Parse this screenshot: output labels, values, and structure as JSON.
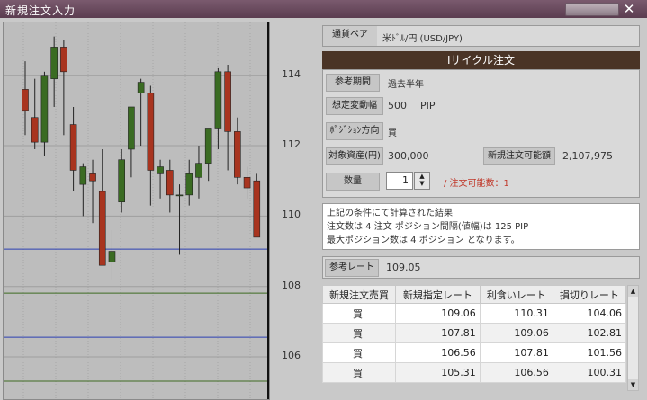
{
  "window": {
    "title": "新規注文入力",
    "close_glyph": "✕"
  },
  "pair": {
    "label": "通貨ペア",
    "value": "米ﾄﾞﾙ/円 (USD/JPY)"
  },
  "cycle": {
    "header": "Iサイクル注文",
    "period_label": "参考期間",
    "period_value": "過去半年",
    "range_label": "想定変動幅",
    "range_value": "500",
    "range_unit": "PIP",
    "direction_label": "ﾎﾟｼﾞｼｮﾝ方向",
    "direction_value": "買",
    "assets_label": "対象資産(円)",
    "assets_value": "300,000",
    "available_label": "新規注文可能額",
    "available_value": "2,107,975",
    "qty_label": "数量",
    "qty_value": "1",
    "qty_note": "/ 注文可能数：1"
  },
  "result": {
    "line1": "上記の条件にて計算された結果",
    "line2": "注文数は 4 注文 ポジション間隔(値幅)は 125 PIP",
    "line3": "最大ポジション数は 4 ポジション となります。"
  },
  "ref_rate": {
    "label": "参考レート",
    "value": "109.05"
  },
  "orders": {
    "headers": [
      "新規注文売買",
      "新規指定レート",
      "利食いレート",
      "損切りレート"
    ],
    "rows": [
      [
        "買",
        "109.06",
        "110.31",
        "104.06"
      ],
      [
        "買",
        "107.81",
        "109.06",
        "102.81"
      ],
      [
        "買",
        "106.56",
        "107.81",
        "101.56"
      ],
      [
        "買",
        "105.31",
        "106.56",
        "100.31"
      ]
    ]
  },
  "axis_ticks": [
    "114",
    "112",
    "110",
    "108",
    "106"
  ],
  "chart_data": {
    "type": "candlestick",
    "ylim": [
      104.8,
      115.5
    ],
    "candles": [
      {
        "o": 113.6,
        "h": 114.4,
        "l": 112.3,
        "c": 113.0
      },
      {
        "o": 112.8,
        "h": 113.9,
        "l": 111.9,
        "c": 112.1
      },
      {
        "o": 112.1,
        "h": 114.1,
        "l": 111.7,
        "c": 114.0
      },
      {
        "o": 113.9,
        "h": 115.1,
        "l": 113.1,
        "c": 114.8
      },
      {
        "o": 114.8,
        "h": 115.0,
        "l": 112.3,
        "c": 114.1
      },
      {
        "o": 112.6,
        "h": 113.1,
        "l": 110.7,
        "c": 111.3
      },
      {
        "o": 110.9,
        "h": 111.5,
        "l": 110.0,
        "c": 111.4
      },
      {
        "o": 111.2,
        "h": 111.6,
        "l": 109.8,
        "c": 111.0
      },
      {
        "o": 110.7,
        "h": 111.9,
        "l": 108.6,
        "c": 108.6
      },
      {
        "o": 108.7,
        "h": 109.6,
        "l": 108.2,
        "c": 109.0
      },
      {
        "o": 110.4,
        "h": 111.9,
        "l": 110.1,
        "c": 111.6
      },
      {
        "o": 111.9,
        "h": 112.9,
        "l": 111.1,
        "c": 113.1
      },
      {
        "o": 113.5,
        "h": 113.9,
        "l": 112.0,
        "c": 113.8
      },
      {
        "o": 113.5,
        "h": 113.7,
        "l": 110.3,
        "c": 111.3
      },
      {
        "o": 111.2,
        "h": 111.6,
        "l": 110.5,
        "c": 111.4
      },
      {
        "o": 111.3,
        "h": 111.6,
        "l": 110.1,
        "c": 110.6
      },
      {
        "o": 110.6,
        "h": 110.9,
        "l": 108.9,
        "c": 110.6
      },
      {
        "o": 110.6,
        "h": 111.6,
        "l": 110.3,
        "c": 111.2
      },
      {
        "o": 111.1,
        "h": 112.0,
        "l": 110.5,
        "c": 111.5
      },
      {
        "o": 111.5,
        "h": 112.4,
        "l": 111.0,
        "c": 112.5
      },
      {
        "o": 112.5,
        "h": 114.2,
        "l": 111.9,
        "c": 114.1
      },
      {
        "o": 114.1,
        "h": 114.3,
        "l": 111.3,
        "c": 112.4
      },
      {
        "o": 112.4,
        "h": 112.8,
        "l": 110.9,
        "c": 111.1
      },
      {
        "o": 111.1,
        "h": 111.4,
        "l": 110.5,
        "c": 110.8
      },
      {
        "o": 111.0,
        "h": 111.2,
        "l": 109.5,
        "c": 109.4
      }
    ],
    "hlines": [
      {
        "price": 109.06,
        "color": "#2c3fb3"
      },
      {
        "price": 107.81,
        "color": "#3e6b22"
      },
      {
        "price": 106.56,
        "color": "#2c3fb3"
      },
      {
        "price": 105.31,
        "color": "#3e6b22"
      }
    ],
    "grid": [
      114,
      112,
      110,
      108,
      106
    ],
    "up_color": "#3a6b22",
    "down_color": "#a8341f"
  }
}
